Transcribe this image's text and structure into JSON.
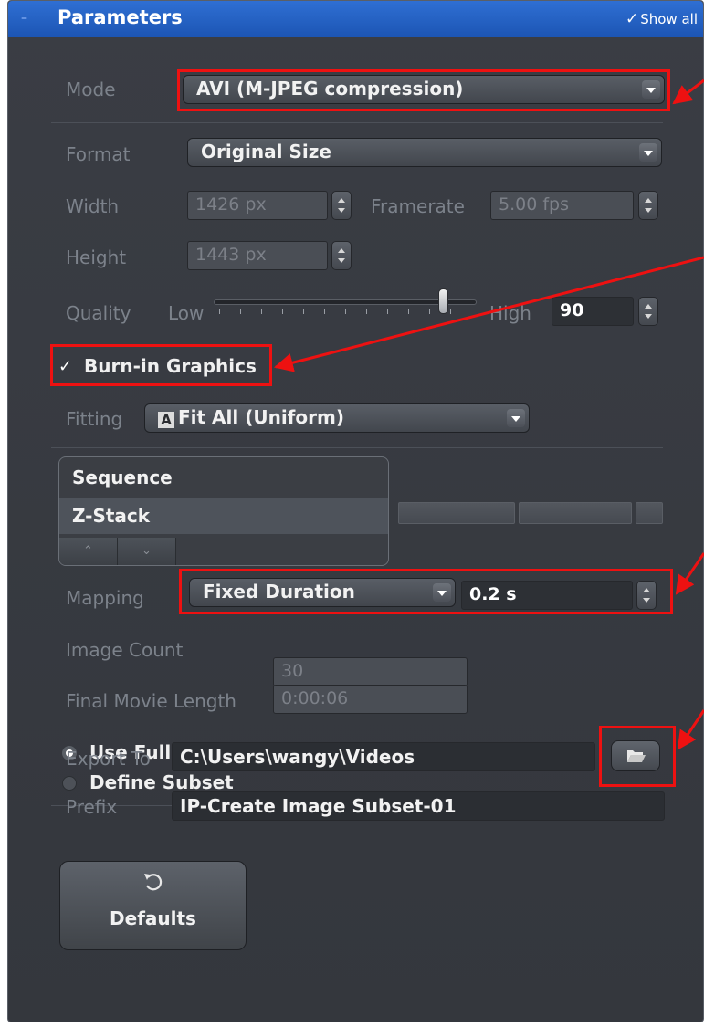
{
  "panel": {
    "title": "Parameters",
    "show_all_label": "Show all"
  },
  "mode": {
    "label": "Mode",
    "value": "AVI (M-JPEG compression)"
  },
  "format": {
    "label": "Format",
    "value": "Original Size"
  },
  "width": {
    "label": "Width",
    "value": "1426 px"
  },
  "framerate": {
    "label": "Framerate",
    "value": "5.00 fps"
  },
  "height": {
    "label": "Height",
    "value": "1443 px"
  },
  "quality": {
    "label": "Quality",
    "low_label": "Low",
    "high_label": "High",
    "value": "90",
    "slider_fraction": 0.9
  },
  "burn_in": {
    "label": "Burn-in Graphics",
    "checked": true
  },
  "fitting": {
    "label": "Fitting",
    "icon_letter": "A",
    "value": "Fit All (Uniform)"
  },
  "dimensions_list": {
    "items": [
      "Sequence",
      "Z-Stack"
    ],
    "selected": "Z-Stack"
  },
  "mapping": {
    "label": "Mapping",
    "value": "Fixed Duration",
    "duration": "0.2 s"
  },
  "image_count": {
    "label": "Image Count",
    "value": "30"
  },
  "final_movie_length": {
    "label": "Final Movie Length",
    "value": "0:00:06"
  },
  "dimension_options": [
    {
      "label": "Use Full Set of Dimensions",
      "selected": true
    },
    {
      "label": "Define Subset",
      "selected": false
    }
  ],
  "export_to": {
    "label": "Export To",
    "value": "C:\\Users\\wangy\\Videos"
  },
  "prefix": {
    "label": "Prefix",
    "value": "IP-Create Image Subset-01"
  },
  "defaults_button": {
    "label": "Defaults"
  },
  "icons": [
    "collapse-icon",
    "checkmark-icon",
    "dropdown-arrow-icon",
    "spinner-icon",
    "folder-open-icon",
    "reset-icon",
    "fit-all-icon"
  ],
  "colors": {
    "title_bar": "#1f5cc0",
    "panel_bg": "#383b41",
    "annotation_red": "#ee1111"
  }
}
